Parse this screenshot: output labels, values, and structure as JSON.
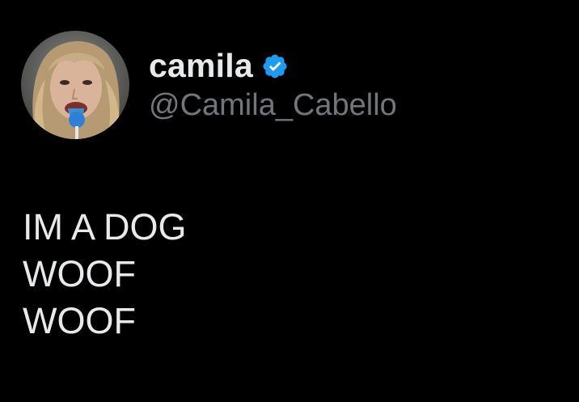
{
  "tweet": {
    "author": {
      "display_name": "camila",
      "handle": "@Camila_Cabello",
      "verified": true,
      "avatar_icon": "profile-photo"
    },
    "text_lines": [
      "IM A DOG",
      "WOOF",
      "WOOF"
    ]
  },
  "colors": {
    "background": "#000000",
    "primary_text": "#e7e9ea",
    "secondary_text": "#71767b",
    "verified_badge": "#1d9bf0"
  }
}
